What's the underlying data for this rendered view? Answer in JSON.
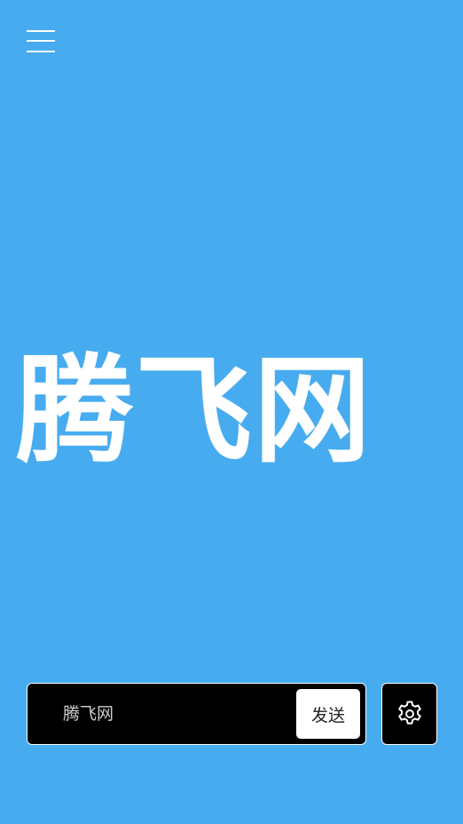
{
  "header": {
    "menu_icon": "hamburger-menu-icon"
  },
  "logo": {
    "text": "腾飞网"
  },
  "search": {
    "placeholder": "腾飞网",
    "value": "",
    "send_label": "发送"
  },
  "settings": {
    "icon": "gear-icon"
  },
  "colors": {
    "background": "#46abef",
    "bar_background": "#000000",
    "accent": "#ffffff"
  }
}
